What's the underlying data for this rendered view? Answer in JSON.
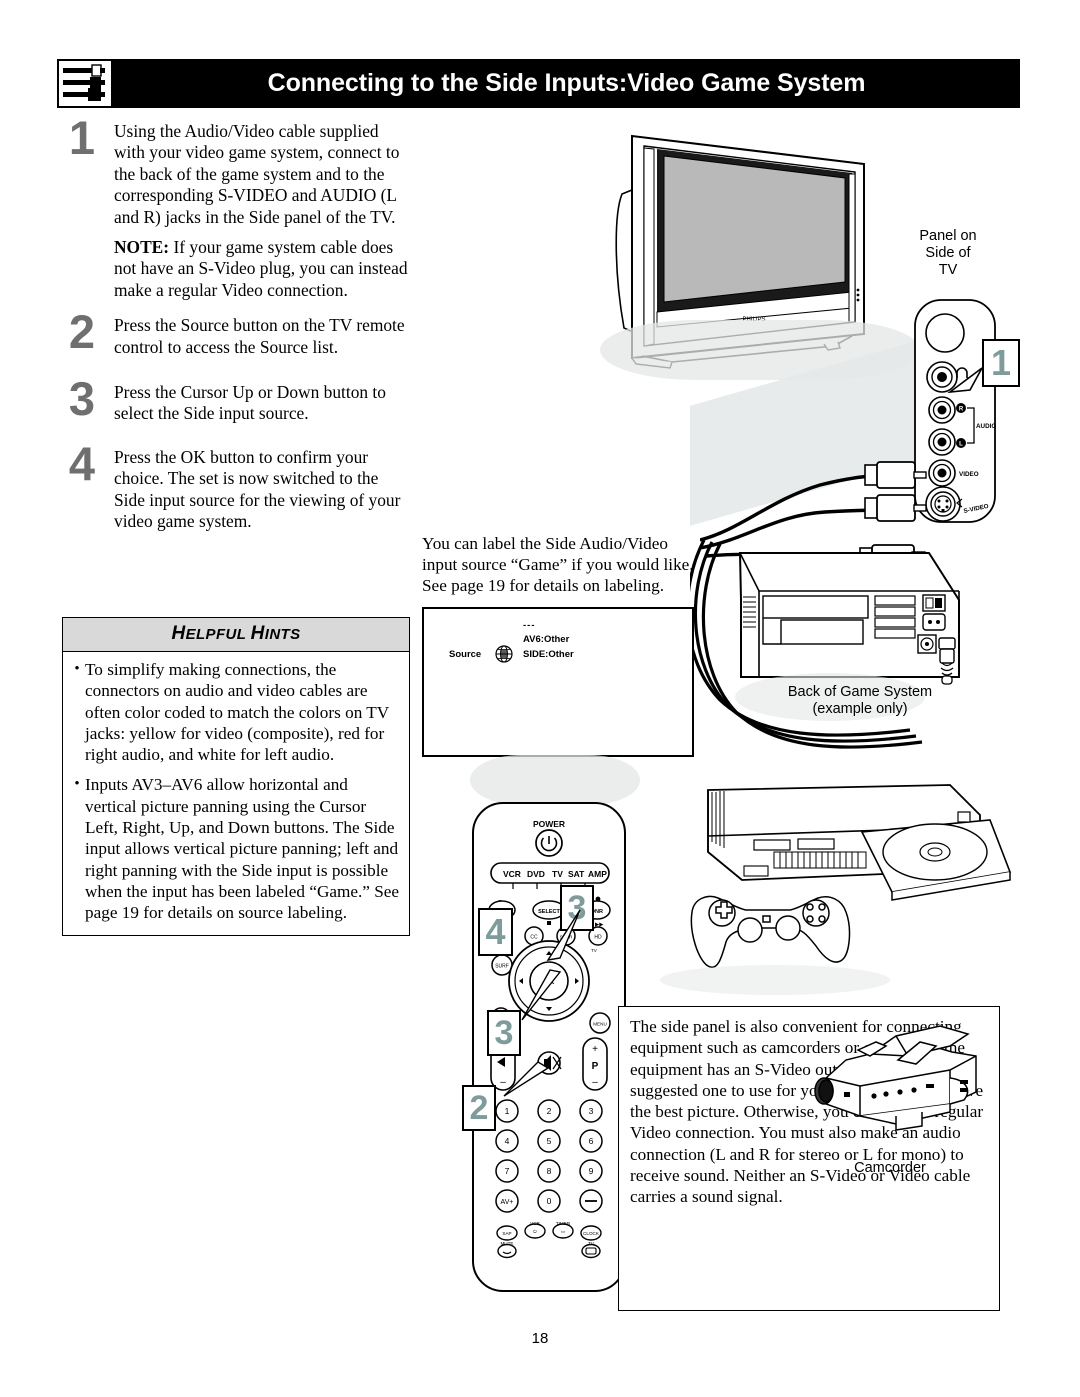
{
  "header": {
    "title": "Connecting to the Side Inputs:Video Game System",
    "icon": "av-cables-icon"
  },
  "steps": [
    {
      "number": "1",
      "paragraphs": [
        "Using the Audio/Video cable supplied with your video game system, connect to the back of the game system and to the corresponding S-VIDEO and AUDIO (L and R) jacks in the Side panel of the TV.",
        "NOTE: If your game system cable does not have an S-Video plug, you can instead make a regular Video connection."
      ],
      "note_prefix": "NOTE:"
    },
    {
      "number": "2",
      "paragraphs": [
        "Press the Source button on the TV remote control to access the Source list."
      ]
    },
    {
      "number": "3",
      "paragraphs": [
        "Press the Cursor Up or Down button to select the Side input source."
      ]
    },
    {
      "number": "4",
      "paragraphs": [
        "Press the OK button to confirm your choice. The set is now switched to the Side input source for the viewing of your video game system."
      ]
    }
  ],
  "hints": {
    "title_first_letter": "H",
    "title_rest_one": "ELPFUL ",
    "title_second_letter": "H",
    "title_rest_two": "INTS",
    "title_full": "HELPFUL HINTS",
    "bullet_glyph": "•",
    "items": [
      "To simplify making connections, the connectors on audio and video cables are often color coded to match the colors on TV jacks: yellow for video (composite), red for right audio, and white for left audio.",
      "Inputs AV3–AV6 allow horizontal and vertical picture panning using the Cursor Left, Right, Up, and Down buttons. The Side input allows vertical picture panning; left and right panning with the Side input is possible when the input has been labeled “Game.” See page 19 for details on source labeling."
    ]
  },
  "figures": {
    "tv": {
      "name": "flat-panel-tv",
      "brand": "PHILIPS"
    },
    "panel_label": "Panel on\nSide of\nTV",
    "panel_label_lines": [
      "Panel on",
      "Side of",
      "TV"
    ],
    "side_panel_jacks": [
      {
        "label": "",
        "name": "headphone-jack",
        "symbol": "headphone"
      },
      {
        "label": "R",
        "name": "audio-right-jack"
      },
      {
        "label": "AUDIO",
        "name": "audio-group-label"
      },
      {
        "label": "L",
        "name": "audio-left-jack"
      },
      {
        "label": "VIDEO",
        "name": "video-jack"
      },
      {
        "label": "S-VIDEO",
        "name": "s-video-jack"
      }
    ],
    "game_system_label_lines": [
      "Back of Game System",
      "(example only)"
    ],
    "camcorder_label": "Camcorder"
  },
  "callouts": [
    {
      "value": "1",
      "target": "side-panel-jacks"
    },
    {
      "value": "2",
      "target": "remote-source-button"
    },
    {
      "value": "3",
      "target": "remote-cursor-buttons"
    },
    {
      "value": "4",
      "target": "remote-ok-button"
    },
    {
      "value": "3",
      "target": "remote-cursor-up"
    }
  ],
  "source_note": "You can label the Side Audio/Video input source “Game” if you would like. See page 19 for details on labeling.",
  "osd": {
    "menu_label": "Source",
    "icon": "source-globe-icon",
    "items": [
      "AV6:Other",
      "SIDE:Other"
    ],
    "ellipsis": "---"
  },
  "remote": {
    "power_label": "POWER",
    "power_icon": "power-icon",
    "device_buttons": [
      "VCR",
      "DVD",
      "TV",
      "SAT",
      "AMP"
    ],
    "row_buttons": [
      "INFO",
      "SELECT",
      "DNR"
    ],
    "row2_buttons": [
      "TU",
      "CC",
      "SURR",
      "HD"
    ],
    "surf_button": "SURF",
    "ok_button": "OK",
    "menu_button": "MENU",
    "volume": {
      "plus": "+",
      "minus": "–",
      "icon": "volume-icon"
    },
    "channel": {
      "plus": "+",
      "minus": "–",
      "label": "P"
    },
    "mute_icon": "mute-icon",
    "numbers": [
      "1",
      "2",
      "3",
      "4",
      "5",
      "6",
      "7",
      "8",
      "9",
      "0"
    ],
    "av_button": "AV+",
    "dash_button": "–",
    "bottom_buttons": [
      "SAP",
      "VCR",
      "TIMER",
      "CLOCK",
      "MUTE",
      "TV"
    ]
  },
  "camcorder_text": "The side panel is also convenient for connecting equipment such as camcorders or cameras. If the equipment has an S-Video output jack, it is the suggested one to use for your connection to receive the best picture. Otherwise, you can make a regular Video connection. You must also make an audio connection (L and R for stereo or L for mono) to receive sound. Neither an S-Video or Video cable carries a sound signal.",
  "camcorder_text_col": "The side panel is also convenient for connecting equipment such as camcorders or cameras. If the equipment has an S-Video output jack, it is the suggested one to use",
  "camcorder_text_full": "for your connection to receive the best picture. Otherwise, you can make a regular Video connection. You must also make an audio connection (L and R for stereo or L for mono) to receive sound. Neither an S-Video or Video cable carries a sound signal.",
  "page_number": "18",
  "colors": {
    "header_bar": "#000000",
    "header_text": "#ffffff",
    "step_number": "#6f6f6f",
    "callout_number": "#7f9b9b",
    "hints_header_bg": "#d9d9d9",
    "shade": "#e4e7e7"
  }
}
